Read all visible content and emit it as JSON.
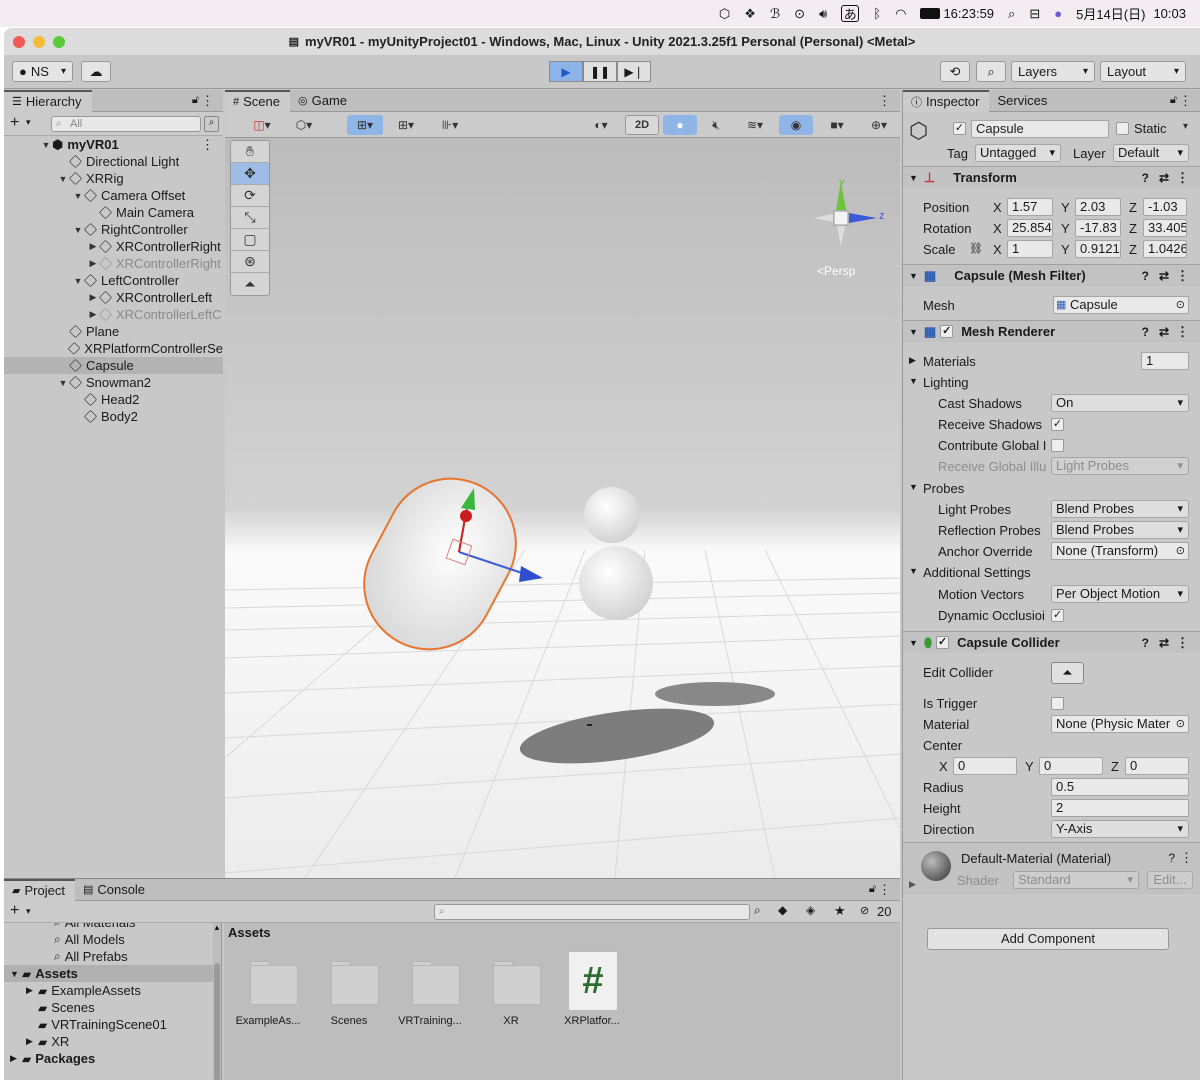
{
  "menubar": {
    "time": "16:23:59",
    "date": "5月14日(日)",
    "clock": "10:03",
    "ime": "あ"
  },
  "window": {
    "title": "myVR01 - myUnityProject01 - Windows, Mac, Linux - Unity 2021.3.25f1 Personal (Personal) <Metal>"
  },
  "toolbar": {
    "account": "NS",
    "layers": "Layers",
    "layout": "Layout"
  },
  "hierarchy": {
    "tab": "Hierarchy",
    "search_placeholder": "All",
    "rows": [
      {
        "label": "myVR01",
        "indent": 0,
        "arrow": "▼",
        "bold": true,
        "root": true
      },
      {
        "label": "Directional Light",
        "indent": 1,
        "arrow": ""
      },
      {
        "label": "XRRig",
        "indent": 1,
        "arrow": "▼"
      },
      {
        "label": "Camera Offset",
        "indent": 2,
        "arrow": "▼"
      },
      {
        "label": "Main Camera",
        "indent": 3,
        "arrow": ""
      },
      {
        "label": "RightController",
        "indent": 2,
        "arrow": "▼"
      },
      {
        "label": "XRControllerRight",
        "indent": 3,
        "arrow": "▶"
      },
      {
        "label": "XRControllerRight",
        "indent": 3,
        "arrow": "▶",
        "dim": true
      },
      {
        "label": "LeftController",
        "indent": 2,
        "arrow": "▼"
      },
      {
        "label": "XRControllerLeft",
        "indent": 3,
        "arrow": "▶"
      },
      {
        "label": "XRControllerLeftC",
        "indent": 3,
        "arrow": "▶",
        "dim": true
      },
      {
        "label": "Plane",
        "indent": 1,
        "arrow": ""
      },
      {
        "label": "XRPlatformControllerSe",
        "indent": 1,
        "arrow": ""
      },
      {
        "label": "Capsule",
        "indent": 1,
        "arrow": "",
        "selected": true
      },
      {
        "label": "Snowman2",
        "indent": 1,
        "arrow": "▼"
      },
      {
        "label": "Head2",
        "indent": 2,
        "arrow": ""
      },
      {
        "label": "Body2",
        "indent": 2,
        "arrow": ""
      }
    ]
  },
  "scene": {
    "tab_scene": "Scene",
    "tab_game": "Game",
    "btn_2d": "2D",
    "persp": "<Persp",
    "axis_y": "y",
    "axis_z": "z"
  },
  "inspector": {
    "tab": "Inspector",
    "tab2": "Services",
    "object_name": "Capsule",
    "static_label": "Static",
    "tag_label": "Tag",
    "tag_value": "Untagged",
    "layer_label": "Layer",
    "layer_value": "Default",
    "transform": {
      "title": "Transform",
      "position_label": "Position",
      "rotation_label": "Rotation",
      "scale_label": "Scale",
      "pos": [
        "1.57",
        "2.03",
        "-1.03"
      ],
      "rot": [
        "25.854",
        "-17.83",
        "33.405"
      ],
      "scale": [
        "1",
        "0.9121",
        "1.0426"
      ]
    },
    "meshfilter": {
      "title": "Capsule (Mesh Filter)",
      "mesh_label": "Mesh",
      "mesh_value": "Capsule"
    },
    "renderer": {
      "title": "Mesh Renderer",
      "materials_label": "Materials",
      "materials_count": "1",
      "lighting_label": "Lighting",
      "cast_shadows_label": "Cast Shadows",
      "cast_shadows": "On",
      "receive_shadows_label": "Receive Shadows",
      "contribute_gi_label": "Contribute Global I",
      "receive_gi_label": "Receive Global Illu",
      "receive_gi_value": "Light Probes",
      "probes_label": "Probes",
      "light_probes_label": "Light Probes",
      "light_probes": "Blend Probes",
      "refl_probes_label": "Reflection Probes",
      "refl_probes": "Blend Probes",
      "anchor_label": "Anchor Override",
      "anchor_value": "None (Transform)",
      "additional_label": "Additional Settings",
      "motion_label": "Motion Vectors",
      "motion_value": "Per Object Motion",
      "dynamic_label": "Dynamic Occlusioi"
    },
    "collider": {
      "title": "Capsule Collider",
      "edit_label": "Edit Collider",
      "trigger_label": "Is Trigger",
      "material_label": "Material",
      "material_value": "None (Physic Mater",
      "center_label": "Center",
      "center": [
        "0",
        "0",
        "0"
      ],
      "radius_label": "Radius",
      "radius": "0.5",
      "height_label": "Height",
      "height": "2",
      "direction_label": "Direction",
      "direction": "Y-Axis"
    },
    "material": {
      "name": "Default-Material (Material)",
      "shader_label": "Shader",
      "shader_value": "Standard",
      "edit": "Edit..."
    },
    "add_component": "Add Component",
    "axes": {
      "x": "X",
      "y": "Y",
      "z": "Z"
    }
  },
  "project": {
    "tab": "Project",
    "tab2": "Console",
    "count": "20",
    "assets_header": "Assets",
    "tree": [
      {
        "label": "All Materials",
        "indent": 2,
        "type": "search",
        "cut": true
      },
      {
        "label": "All Models",
        "indent": 2,
        "type": "search"
      },
      {
        "label": "All Prefabs",
        "indent": 2,
        "type": "search"
      },
      {
        "label": "Assets",
        "indent": 0,
        "type": "folder",
        "arrow": "▼",
        "bold": true,
        "sel": true
      },
      {
        "label": "ExampleAssets",
        "indent": 1,
        "type": "folder",
        "arrow": "▶"
      },
      {
        "label": "Scenes",
        "indent": 1,
        "type": "folder",
        "arrow": ""
      },
      {
        "label": "VRTrainingScene01",
        "indent": 1,
        "type": "folder",
        "arrow": ""
      },
      {
        "label": "XR",
        "indent": 1,
        "type": "folder",
        "arrow": "▶"
      },
      {
        "label": "Packages",
        "indent": 0,
        "type": "folder",
        "arrow": "▶",
        "bold": true
      }
    ],
    "items": [
      {
        "label": "ExampleAs...",
        "kind": "folder"
      },
      {
        "label": "Scenes",
        "kind": "folder"
      },
      {
        "label": "VRTraining...",
        "kind": "folder"
      },
      {
        "label": "XR",
        "kind": "folder"
      },
      {
        "label": "XRPlatfor...",
        "kind": "script"
      }
    ]
  }
}
